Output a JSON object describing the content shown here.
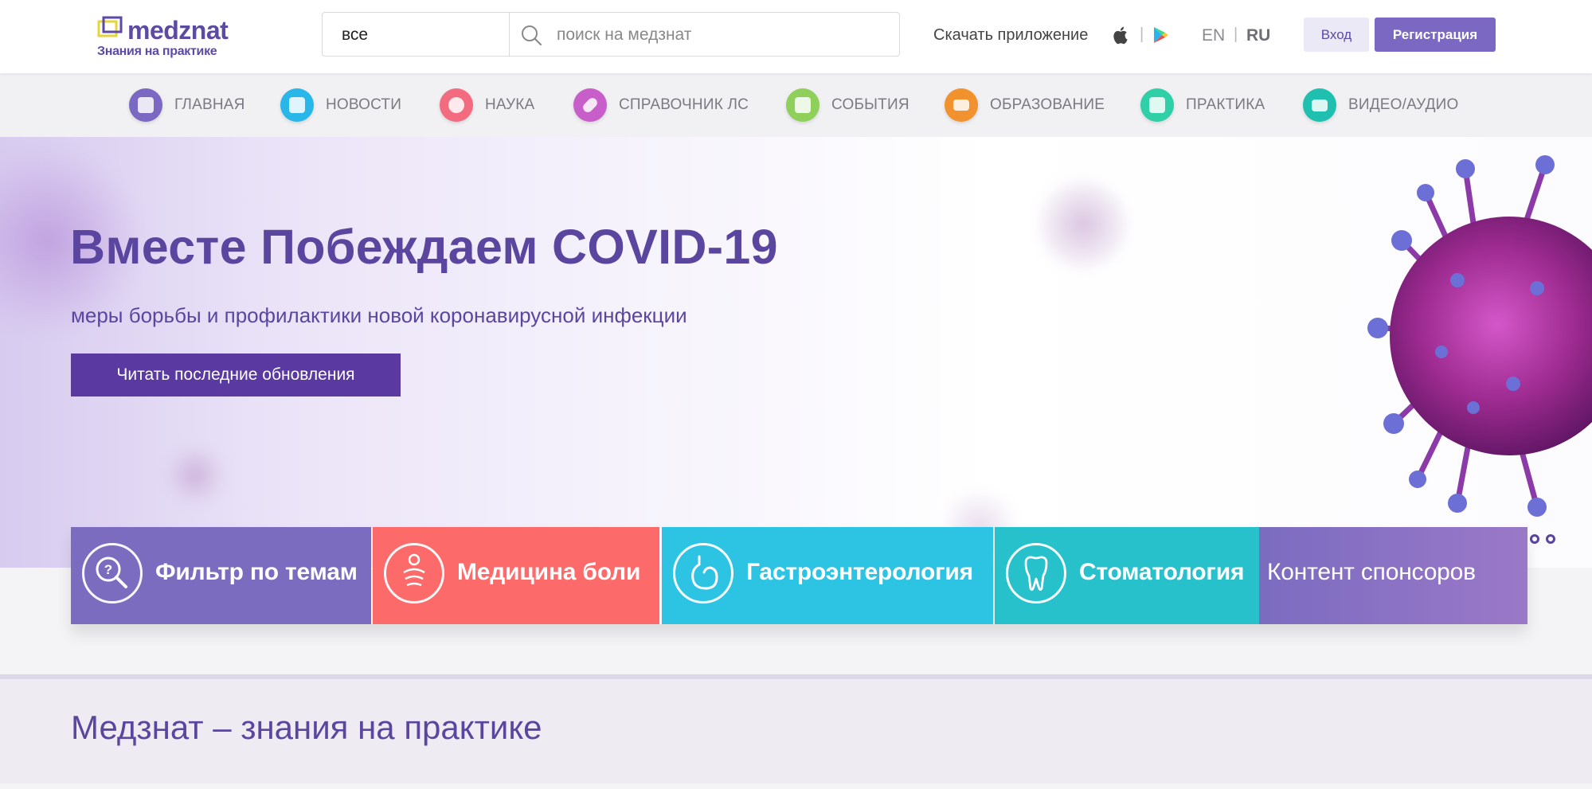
{
  "header": {
    "logo_word": "medznat",
    "logo_tagline": "Знания на практике",
    "search_scope": "все",
    "search_placeholder": "поиск на медзнат",
    "download_app_label": "Скачать приложение",
    "lang_en": "EN",
    "lang_ru": "RU",
    "lang_separator": "|",
    "login_label": "Вход",
    "register_label": "Регистрация"
  },
  "nav": {
    "items": [
      {
        "label": "ГЛАВНАЯ",
        "icon": "home-icon",
        "color": "#7a68c2"
      },
      {
        "label": "НОВОСТИ",
        "icon": "news-icon",
        "color": "#29b6e8"
      },
      {
        "label": "НАУКА",
        "icon": "atom-icon",
        "color": "#f36b7f"
      },
      {
        "label": "СПРАВОЧНИК ЛС",
        "icon": "pill-icon",
        "color": "#c75ec9"
      },
      {
        "label": "СОБЫТИЯ",
        "icon": "calendar-icon",
        "color": "#8fd05a"
      },
      {
        "label": "ОБРАЗОВАНИЕ",
        "icon": "book-icon",
        "color": "#f2922f"
      },
      {
        "label": "ПРАКТИКА",
        "icon": "medkit-icon",
        "color": "#2fcfa8"
      },
      {
        "label": "ВИДЕО/АУДИО",
        "icon": "tv-icon",
        "color": "#1fc0b0"
      }
    ]
  },
  "hero": {
    "title": "Вместе Побеждаем COVID-19",
    "subtitle": "меры борьбы и профилактики новой коронавирусной инфекции",
    "cta_label": "Читать последние обновления"
  },
  "tiles": [
    {
      "label": "Фильтр по темам",
      "icon": "question-search-icon",
      "color": "#7b6cc0"
    },
    {
      "label": "Медицина боли",
      "icon": "pain-icon",
      "color": "#fd6a6a"
    },
    {
      "label": "Гастроэнтерология",
      "icon": "stomach-icon",
      "color": "#2dc4e4"
    },
    {
      "label": "Стоматология",
      "icon": "tooth-icon",
      "color": "#27c1cc"
    },
    {
      "label": "Контент спонсоров",
      "icon": "",
      "color": "#8e72c6"
    }
  ],
  "bottom": {
    "title": "Медзнат – знания на практике"
  },
  "colors": {
    "brand": "#5b469f",
    "accent": "#7a68c2"
  }
}
